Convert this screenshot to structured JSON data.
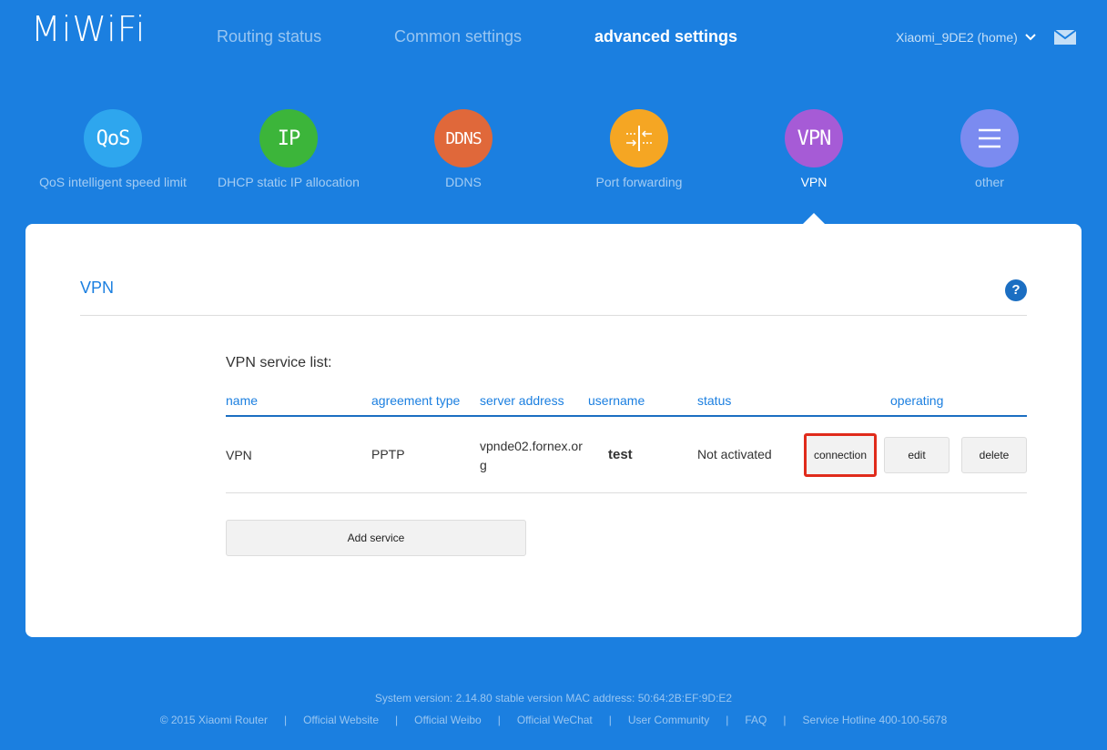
{
  "header": {
    "logo": "MiWiFi",
    "nav": [
      "Routing status",
      "Common settings",
      "advanced settings"
    ],
    "router_name": "Xiaomi_9DE2 (home)"
  },
  "features": [
    {
      "icon_text": "QoS",
      "label": "QoS intelligent speed limit",
      "color": "#2ea6ee"
    },
    {
      "icon_text": "IP",
      "label": "DHCP static IP allocation",
      "color": "#3cb53a"
    },
    {
      "icon_text": "DDNS",
      "label": "DDNS",
      "color": "#e0683a"
    },
    {
      "icon_text": "",
      "label": "Port forwarding",
      "color": "#f5a623"
    },
    {
      "icon_text": "VPN",
      "label": "VPN",
      "color": "#a65bd6"
    },
    {
      "icon_text": "",
      "label": "other",
      "color": "#7b8bf0"
    }
  ],
  "panel": {
    "title": "VPN",
    "help": "?",
    "list_title": "VPN service list:",
    "columns": [
      "name",
      "agreement type",
      "server address",
      "username",
      "status",
      "operating"
    ],
    "rows": [
      {
        "name": "VPN",
        "agreement_type": "PPTP",
        "server_address_l1": "vpnde02.fornex.or",
        "server_address_l2": "g",
        "username": "test",
        "status": "Not activated",
        "actions": [
          "connection",
          "edit",
          "delete"
        ]
      }
    ],
    "add_service": "Add service"
  },
  "footer": {
    "system": "System version: 2.14.80 stable version MAC address: 50:64:2B:EF:9D:E2",
    "links": [
      "© 2015 Xiaomi Router",
      "Official Website",
      "Official Weibo",
      "Official WeChat",
      "User Community",
      "FAQ",
      "Service Hotline 400-100-5678"
    ]
  }
}
